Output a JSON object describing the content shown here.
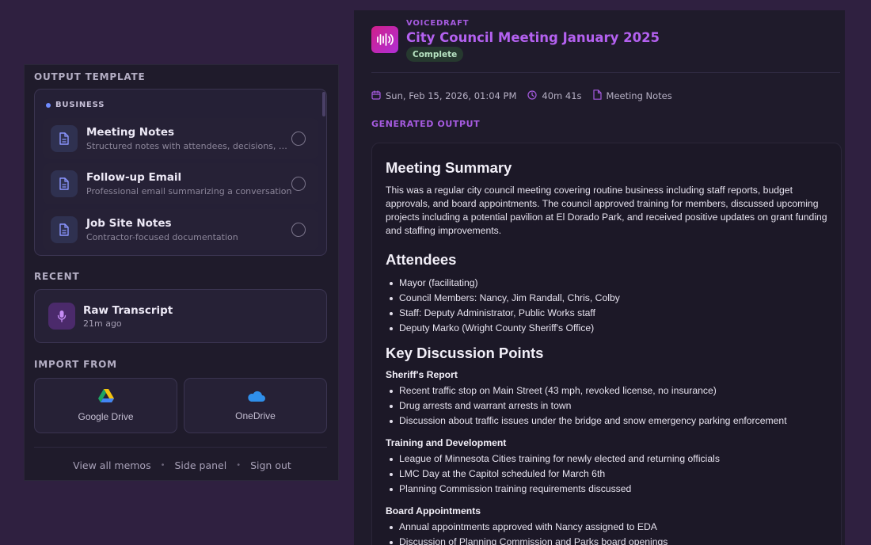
{
  "left": {
    "template_section_title": "OUTPUT TEMPLATE",
    "group_label": "BUSINESS",
    "templates": [
      {
        "name": "Meeting Notes",
        "desc": "Structured notes with attendees, decisions, and..."
      },
      {
        "name": "Follow-up Email",
        "desc": "Professional email summarizing a conversation"
      },
      {
        "name": "Job Site Notes",
        "desc": "Contractor-focused documentation"
      }
    ],
    "recent_section_title": "RECENT",
    "recent": {
      "name": "Raw Transcript",
      "time": "21m ago"
    },
    "import_section_title": "IMPORT FROM",
    "imports": [
      {
        "label": "Google Drive",
        "icon": "google-drive-icon"
      },
      {
        "label": "OneDrive",
        "icon": "onedrive-icon"
      }
    ],
    "footer": {
      "view_all": "View all memos",
      "side_panel": "Side panel",
      "sign_out": "Sign out",
      "separator": "•"
    }
  },
  "right": {
    "app_name": "VOICEDRAFT",
    "title": "City Council Meeting January 2025",
    "status": "Complete",
    "date": "Sun, Feb 15, 2026, 01:04 PM",
    "duration": "40m 41s",
    "template_used": "Meeting Notes",
    "generated_label": "GENERATED OUTPUT",
    "output": {
      "summary_heading": "Meeting Summary",
      "summary_text": "This was a regular city council meeting covering routine business including staff reports, budget approvals, and board appointments. The council approved training for members, discussed upcoming projects including a potential pavilion at El Dorado Park, and received positive updates on grant funding and staffing improvements.",
      "attendees_heading": "Attendees",
      "attendees": [
        "Mayor (facilitating)",
        "Council Members: Nancy, Jim Randall, Chris, Colby",
        "Staff: Deputy Administrator, Public Works staff",
        "Deputy Marko (Wright County Sheriff's Office)"
      ],
      "points_heading": "Key Discussion Points",
      "sheriff_heading": "Sheriff's Report",
      "sheriff": [
        "Recent traffic stop on Main Street (43 mph, revoked license, no insurance)",
        "Drug arrests and warrant arrests in town",
        "Discussion about traffic issues under the bridge and snow emergency parking enforcement"
      ],
      "training_heading": "Training and Development",
      "training": [
        "League of Minnesota Cities training for newly elected and returning officials",
        "LMC Day at the Capitol scheduled for March 6th",
        "Planning Commission training requirements discussed"
      ],
      "board_heading": "Board Appointments",
      "board": [
        "Annual appointments approved with Nancy assigned to EDA",
        "Discussion of Planning Commission and Parks board openings"
      ]
    }
  },
  "colors": {
    "accent": "#b461f0",
    "background": "#2f2040",
    "panel": "#1f1b2b",
    "status_green": "#b7e3c2"
  }
}
